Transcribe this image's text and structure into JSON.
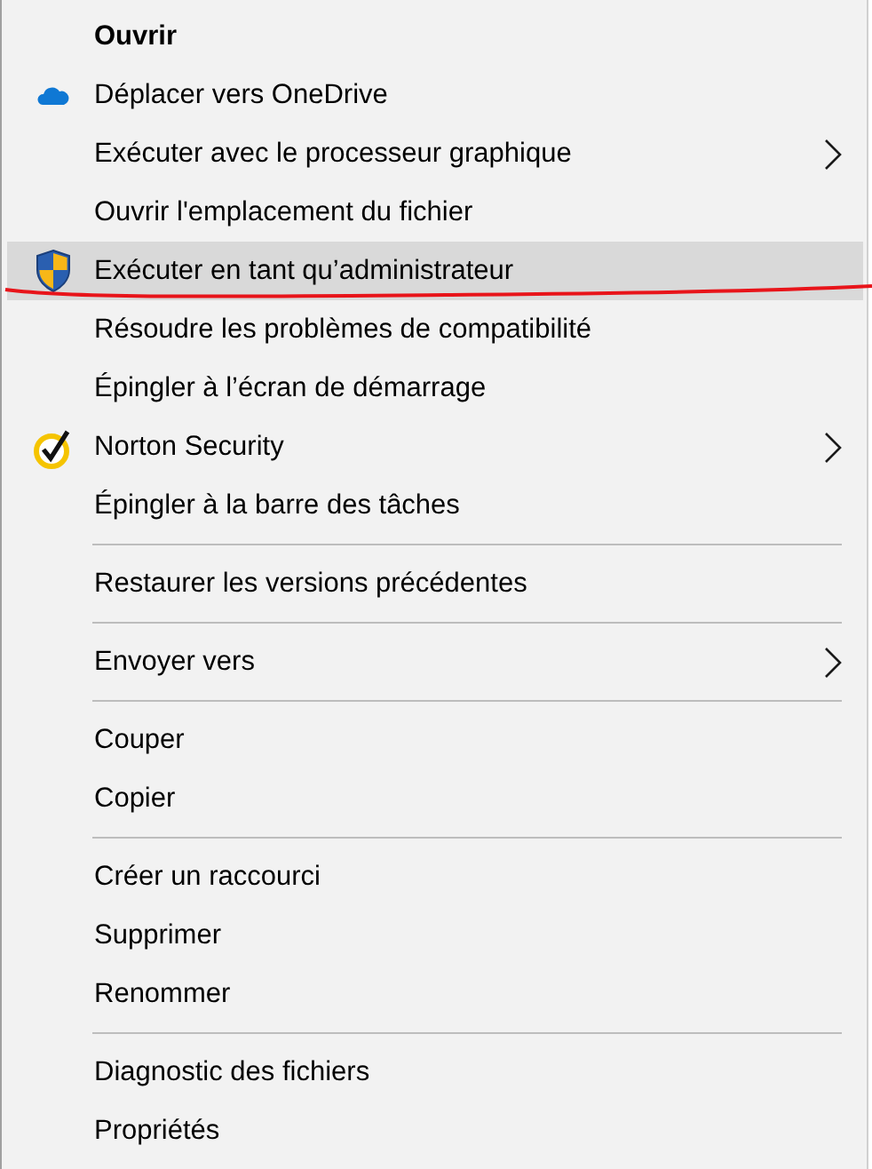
{
  "menu": {
    "items": [
      {
        "kind": "command",
        "label": "Ouvrir",
        "default": true,
        "selected": false,
        "has_submenu": false
      },
      {
        "kind": "cloud-command",
        "label": "Déplacer vers OneDrive",
        "default": false,
        "selected": false,
        "has_submenu": false
      },
      {
        "kind": "command",
        "label": "Exécuter avec le processeur graphique",
        "default": false,
        "selected": false,
        "has_submenu": true
      },
      {
        "kind": "command",
        "label": "Ouvrir l'emplacement du fichier",
        "default": false,
        "selected": false,
        "has_submenu": false
      },
      {
        "kind": "shield-command",
        "label": "Exécuter en tant qu’administrateur",
        "default": false,
        "selected": true,
        "has_submenu": false
      },
      {
        "kind": "command",
        "label": "Résoudre les problèmes de compatibilité",
        "default": false,
        "selected": false,
        "has_submenu": false
      },
      {
        "kind": "command",
        "label": "Épingler à l’écran de démarrage",
        "default": false,
        "selected": false,
        "has_submenu": false
      },
      {
        "kind": "check-command",
        "label": "Norton Security",
        "default": false,
        "selected": false,
        "has_submenu": true
      },
      {
        "kind": "command",
        "label": "Épingler à la barre des tâches",
        "default": false,
        "selected": false,
        "has_submenu": false
      },
      {
        "kind": "separator"
      },
      {
        "kind": "command",
        "label": "Restaurer les versions précédentes",
        "default": false,
        "selected": false,
        "has_submenu": false
      },
      {
        "kind": "separator"
      },
      {
        "kind": "command",
        "label": "Envoyer vers",
        "default": false,
        "selected": false,
        "has_submenu": true
      },
      {
        "kind": "separator"
      },
      {
        "kind": "command",
        "label": "Couper",
        "default": false,
        "selected": false,
        "has_submenu": false
      },
      {
        "kind": "command",
        "label": "Copier",
        "default": false,
        "selected": false,
        "has_submenu": false
      },
      {
        "kind": "separator"
      },
      {
        "kind": "command",
        "label": "Créer un raccourci",
        "default": false,
        "selected": false,
        "has_submenu": false
      },
      {
        "kind": "command",
        "label": "Supprimer",
        "default": false,
        "selected": false,
        "has_submenu": false
      },
      {
        "kind": "command",
        "label": "Renommer",
        "default": false,
        "selected": false,
        "has_submenu": false
      },
      {
        "kind": "separator"
      },
      {
        "kind": "command",
        "label": "Diagnostic des fichiers",
        "default": false,
        "selected": false,
        "has_submenu": false
      },
      {
        "kind": "command",
        "label": "Propriétés",
        "default": false,
        "selected": false,
        "has_submenu": false
      }
    ]
  }
}
